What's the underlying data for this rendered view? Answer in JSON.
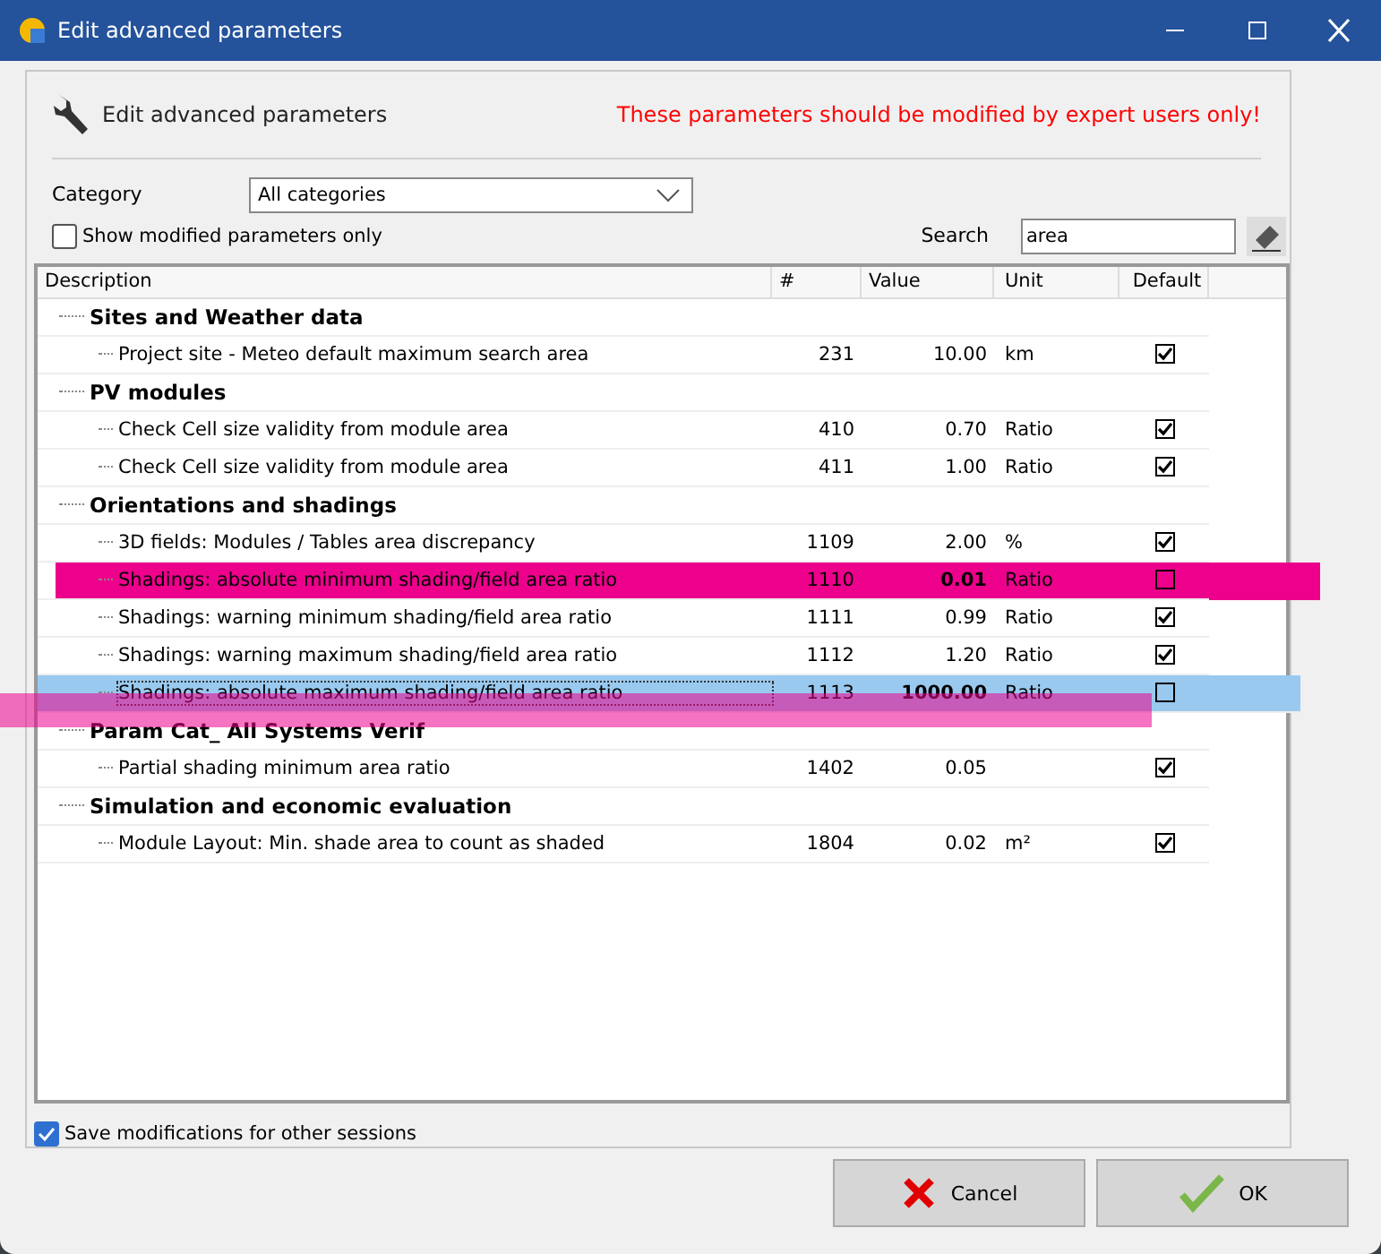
{
  "window": {
    "title": "Edit advanced parameters"
  },
  "header": {
    "title": "Edit advanced parameters",
    "warning": "These parameters should be modified by expert users only!"
  },
  "category": {
    "label": "Category",
    "value": "All categories"
  },
  "modified_only": {
    "label": "Show modified parameters only",
    "checked": false
  },
  "search": {
    "label": "Search",
    "value": "area"
  },
  "table": {
    "columns": [
      "Description",
      "#",
      "Value",
      "Unit",
      "Default"
    ],
    "groups": [
      {
        "name": "Sites and Weather data",
        "children": [
          {
            "description": "Project site - Meteo default maximum search area",
            "number": "231",
            "value": "10.00",
            "unit": "km",
            "default": true,
            "selected": false,
            "highlighted": false
          }
        ]
      },
      {
        "name": "PV modules",
        "children": [
          {
            "description": "Check Cell size validity from module area",
            "number": "410",
            "value": "0.70",
            "unit": "Ratio",
            "default": true,
            "selected": false,
            "highlighted": false
          },
          {
            "description": "Check Cell size validity from module area",
            "number": "411",
            "value": "1.00",
            "unit": "Ratio",
            "default": true,
            "selected": false,
            "highlighted": false
          }
        ]
      },
      {
        "name": "Orientations and shadings",
        "children": [
          {
            "description": "3D fields: Modules / Tables area discrepancy",
            "number": "1109",
            "value": "2.00",
            "unit": "%",
            "default": true,
            "selected": false,
            "highlighted": false
          },
          {
            "description": "Shadings: absolute minimum shading/field area ratio",
            "number": "1110",
            "value": "0.01",
            "unit": "Ratio",
            "default": false,
            "selected": false,
            "highlighted": true
          },
          {
            "description": "Shadings: warning minimum shading/field area ratio",
            "number": "1111",
            "value": "0.99",
            "unit": "Ratio",
            "default": true,
            "selected": false,
            "highlighted": false
          },
          {
            "description": "Shadings: warning maximum shading/field area ratio",
            "number": "1112",
            "value": "1.20",
            "unit": "Ratio",
            "default": true,
            "selected": false,
            "highlighted": false
          },
          {
            "description": "Shadings: absolute maximum shading/field area ratio",
            "number": "1113",
            "value": "1000.00",
            "unit": "Ratio",
            "default": false,
            "selected": true,
            "highlighted": true
          }
        ]
      },
      {
        "name": "Param Cat_ All Systems Verif",
        "children": [
          {
            "description": "Partial shading minimum area ratio",
            "number": "1402",
            "value": "0.05",
            "default": true,
            "selected": false,
            "highlighted": false
          }
        ]
      },
      {
        "name": "Simulation and economic evaluation",
        "children": [
          {
            "description": "Module Layout: Min. shade area to count as shaded",
            "number": "1804",
            "value": "0.02",
            "unit": "m²",
            "default": true,
            "selected": false,
            "highlighted": false
          }
        ]
      }
    ]
  },
  "save_modifications": {
    "label": "Save modifications for other sessions",
    "checked": true
  },
  "buttons": [
    {
      "kind": "cancel",
      "label": "Cancel"
    },
    {
      "kind": "ok",
      "label": "OK"
    }
  ]
}
